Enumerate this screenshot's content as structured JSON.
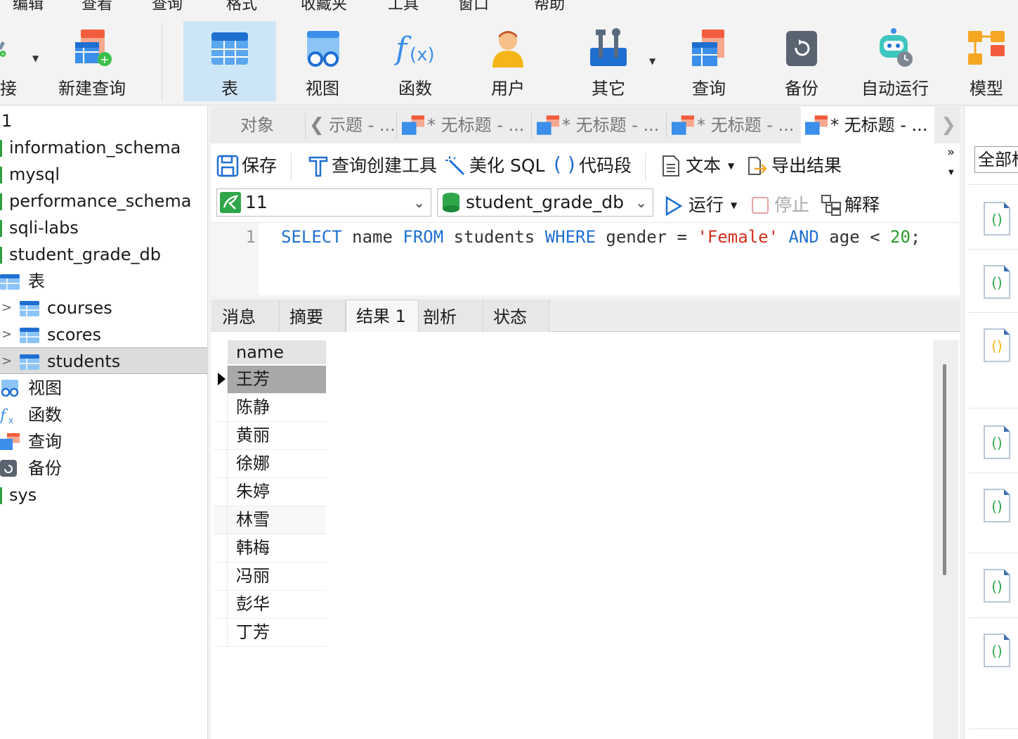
{
  "menu": [
    "编辑",
    "查看",
    "查询",
    "格式",
    "收藏夹",
    "工具",
    "窗口",
    "帮助"
  ],
  "toolbar": {
    "connection_partial": "接",
    "new_query": "新建查询",
    "table": "表",
    "view": "视图",
    "function": "函数",
    "user": "用户",
    "other": "其它",
    "query": "查询",
    "backup": "备份",
    "automation": "自动运行",
    "model": "模型"
  },
  "tree": {
    "connection": "1",
    "databases": [
      "information_schema",
      "mysql",
      "performance_schema",
      "sqli-labs",
      "student_grade_db"
    ],
    "tables_folder": "表",
    "tables": [
      "courses",
      "scores",
      "students"
    ],
    "views_folder": "视图",
    "functions_folder": "函数",
    "queries_folder": "查询",
    "backups_folder": "备份",
    "last_db": "sys"
  },
  "tabs": {
    "objects": "对象",
    "partial": "示题 - ...",
    "untitled": "* 无标题 - ...",
    "current": "* 无标题 - ..."
  },
  "query_toolbar": {
    "save": "保存",
    "builder": "查询创建工具",
    "beautify": "美化 SQL",
    "snippet": "代码段",
    "text": "文本",
    "export": "导出结果",
    "connection": "11",
    "database": "student_grade_db",
    "run": "运行",
    "stop": "停止",
    "explain": "解释"
  },
  "editor": {
    "line_number": "1",
    "tokens": {
      "select": "SELECT",
      "col": " name ",
      "from": "FROM",
      "table": " students ",
      "where": "WHERE",
      "cond": " gender = ",
      "str": "'Female'",
      "and": "AND",
      "cond2": " age < ",
      "num": "20",
      "end": ";"
    }
  },
  "result_tabs": [
    "消息",
    "摘要",
    "结果 1",
    "剖析",
    "状态"
  ],
  "result": {
    "column": "name",
    "rows": [
      "王芳",
      "陈静",
      "黄丽",
      "徐娜",
      "朱婷",
      "林雪",
      "韩梅",
      "冯丽",
      "彭华",
      "丁芳"
    ]
  },
  "right_panel": {
    "search": "全部标签"
  },
  "colors": {
    "accent": "#1f6fd1",
    "string": "#d0321e",
    "number": "#2a9a2a",
    "active_toolbar": "#cde6f7"
  }
}
